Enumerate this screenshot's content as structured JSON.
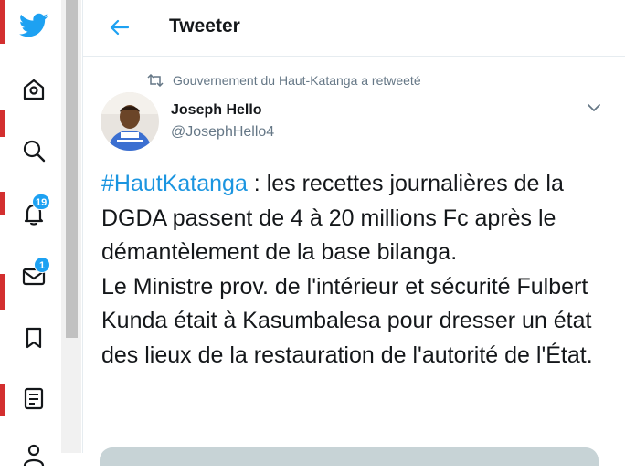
{
  "colors": {
    "accent": "#1da1f2",
    "link": "#1b95e0",
    "text_primary": "#14171a",
    "text_secondary": "#657786"
  },
  "sidebar": {
    "items": [
      {
        "icon": "twitter-bird-icon",
        "label": ""
      },
      {
        "icon": "home-icon",
        "label": ""
      },
      {
        "icon": "search-icon",
        "label": ""
      },
      {
        "icon": "bell-icon",
        "badge": "19"
      },
      {
        "icon": "mail-icon",
        "badge": "1"
      },
      {
        "icon": "bookmark-icon",
        "label": ""
      },
      {
        "icon": "list-icon",
        "label": ""
      },
      {
        "icon": "profile-icon",
        "label": ""
      }
    ]
  },
  "header": {
    "title": "Tweeter"
  },
  "tweet": {
    "retweet_context": "Gouvernement du Haut-Katanga a retweeté",
    "author_name": "Joseph Hello",
    "author_handle": "@JosephHello4",
    "hashtag": "#HautKatanga",
    "text_part1": " : les recettes journalières de la DGDA passent de 4 à 20 millions Fc après le démantèlement de la base bilanga.",
    "text_part2": "Le Ministre prov. de l'intérieur et sécurité Fulbert Kunda était à Kasumbalesa pour dresser un état des lieux de la restauration de l'autorité de l'État."
  }
}
